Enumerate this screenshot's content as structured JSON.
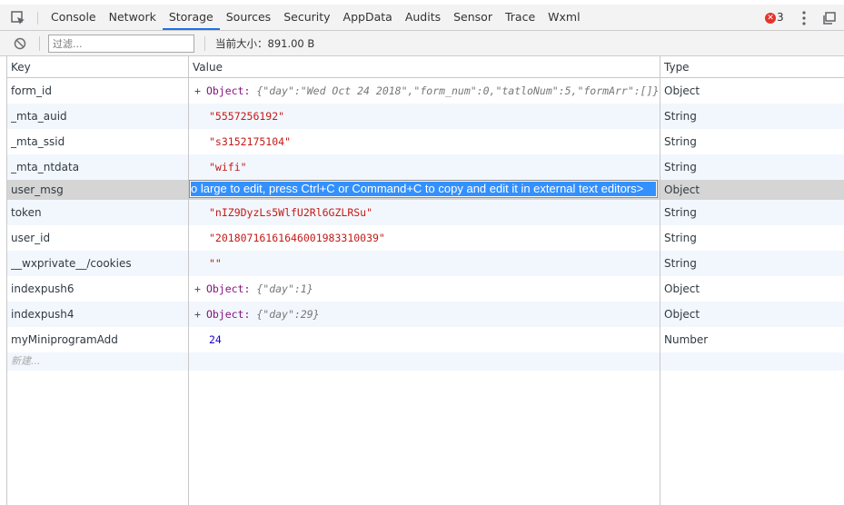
{
  "tabs": [
    {
      "label": "Console",
      "active": false
    },
    {
      "label": "Network",
      "active": false
    },
    {
      "label": "Storage",
      "active": true
    },
    {
      "label": "Sources",
      "active": false
    },
    {
      "label": "Security",
      "active": false
    },
    {
      "label": "AppData",
      "active": false
    },
    {
      "label": "Audits",
      "active": false
    },
    {
      "label": "Sensor",
      "active": false
    },
    {
      "label": "Trace",
      "active": false
    },
    {
      "label": "Wxml",
      "active": false
    }
  ],
  "errors": {
    "icon": "error-x-icon",
    "count": "3",
    "color": "#e8332a"
  },
  "toolbar": {
    "filter_placeholder": "过滤...",
    "size_label": "当前大小：891.00 B"
  },
  "table": {
    "headers": {
      "key": "Key",
      "value": "Value",
      "type": "Type"
    },
    "rows": [
      {
        "key": "form_id",
        "value_kind": "object",
        "value_label": "Object:",
        "value_preview": "{\"day\":\"Wed Oct 24 2018\",\"form_num\":0,\"tatloNum\":5,\"formArr\":[]}",
        "type": "Object"
      },
      {
        "key": "_mta_auid",
        "value_kind": "string",
        "value": "\"5557256192\"",
        "type": "String"
      },
      {
        "key": "_mta_ssid",
        "value_kind": "string",
        "value": "\"s3152175104\"",
        "type": "String"
      },
      {
        "key": "_mta_ntdata",
        "value_kind": "string",
        "value": "\"wifi\"",
        "type": "String"
      },
      {
        "key": "user_msg",
        "value_kind": "editing",
        "value": "o large to edit, press Ctrl+C or Command+C to copy and edit it in external text editors>",
        "type": "Object",
        "selected": true
      },
      {
        "key": "token",
        "value_kind": "string",
        "value": "\"nIZ9DyzLs5WlfU2Rl6GZLRSu\"",
        "type": "String"
      },
      {
        "key": "user_id",
        "value_kind": "string",
        "value": "\"201807161616460019833100​39\"",
        "type": "String"
      },
      {
        "key": "__wxprivate__/cookies",
        "value_kind": "string",
        "value": "\"\"",
        "type": "String"
      },
      {
        "key": "indexpush6",
        "value_kind": "object",
        "value_label": "Object:",
        "value_preview": "{\"day\":1}",
        "type": "Object"
      },
      {
        "key": "indexpush4",
        "value_kind": "object",
        "value_label": "Object:",
        "value_preview": "{\"day\":29}",
        "type": "Object"
      },
      {
        "key": "myMiniprogramAdd",
        "value_kind": "number",
        "value": "24",
        "type": "Number"
      }
    ],
    "new_row_placeholder": "新建..."
  },
  "colors": {
    "accent": "#1a73e8",
    "string": "#c41a16",
    "number": "#1c00cf",
    "object": "#881280",
    "selection": "#3390ff"
  }
}
